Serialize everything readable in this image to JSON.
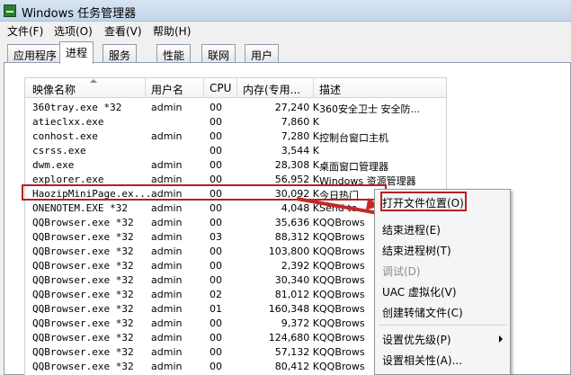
{
  "window": {
    "title": "Windows 任务管理器"
  },
  "menu": [
    "文件(F)",
    "选项(O)",
    "查看(V)",
    "帮助(H)"
  ],
  "tabs": [
    "应用程序",
    "进程",
    "服务",
    "性能",
    "联网",
    "用户"
  ],
  "active_tab": "进程",
  "columns": [
    "映像名称",
    "用户名",
    "CPU",
    "内存(专用...",
    "描述"
  ],
  "rows": [
    {
      "name": "360tray.exe *32",
      "user": "admin",
      "cpu": "00",
      "mem": "27,240 K",
      "desc": "360安全卫士 安全防..."
    },
    {
      "name": "atieclxx.exe",
      "user": "",
      "cpu": "00",
      "mem": "7,860 K",
      "desc": ""
    },
    {
      "name": "conhost.exe",
      "user": "admin",
      "cpu": "00",
      "mem": "7,280 K",
      "desc": "控制台窗口主机"
    },
    {
      "name": "csrss.exe",
      "user": "",
      "cpu": "00",
      "mem": "3,544 K",
      "desc": ""
    },
    {
      "name": "dwm.exe",
      "user": "admin",
      "cpu": "00",
      "mem": "28,308 K",
      "desc": "桌面窗口管理器"
    },
    {
      "name": "explorer.exe",
      "user": "admin",
      "cpu": "00",
      "mem": "56,952 K",
      "desc": "Windows 资源管理器"
    },
    {
      "name": "HaozipMiniPage.ex...",
      "user": "admin",
      "cpu": "00",
      "mem": "30,092 K",
      "desc": "今日热门"
    },
    {
      "name": "ONENOTEM.EXE *32",
      "user": "admin",
      "cpu": "00",
      "mem": "4,048 K",
      "desc": "Send to"
    },
    {
      "name": "QQBrowser.exe *32",
      "user": "admin",
      "cpu": "00",
      "mem": "35,636 K",
      "desc": "QQBrows"
    },
    {
      "name": "QQBrowser.exe *32",
      "user": "admin",
      "cpu": "03",
      "mem": "88,312 K",
      "desc": "QQBrows"
    },
    {
      "name": "QQBrowser.exe *32",
      "user": "admin",
      "cpu": "00",
      "mem": "103,800 K",
      "desc": "QQBrows"
    },
    {
      "name": "QQBrowser.exe *32",
      "user": "admin",
      "cpu": "00",
      "mem": "2,392 K",
      "desc": "QQBrows"
    },
    {
      "name": "QQBrowser.exe *32",
      "user": "admin",
      "cpu": "00",
      "mem": "30,340 K",
      "desc": "QQBrows"
    },
    {
      "name": "QQBrowser.exe *32",
      "user": "admin",
      "cpu": "02",
      "mem": "81,012 K",
      "desc": "QQBrows"
    },
    {
      "name": "QQBrowser.exe *32",
      "user": "admin",
      "cpu": "01",
      "mem": "160,348 K",
      "desc": "QQBrows"
    },
    {
      "name": "QQBrowser.exe *32",
      "user": "admin",
      "cpu": "00",
      "mem": "9,372 K",
      "desc": "QQBrows"
    },
    {
      "name": "QQBrowser.exe *32",
      "user": "admin",
      "cpu": "00",
      "mem": "124,680 K",
      "desc": "QQBrows"
    },
    {
      "name": "QQBrowser.exe *32",
      "user": "admin",
      "cpu": "00",
      "mem": "57,132 K",
      "desc": "QQBrows"
    },
    {
      "name": "QQBrowser.exe *32",
      "user": "admin",
      "cpu": "00",
      "mem": "80,412 K",
      "desc": "QQBrows"
    }
  ],
  "context_menu": [
    "打开文件位置(O)",
    "结束进程(E)",
    "结束进程树(T)",
    "调试(D)",
    "UAC 虚拟化(V)",
    "创建转储文件(C)",
    "设置优先级(P)",
    "设置相关性(A)..."
  ],
  "colors": {
    "highlight": "#b22222",
    "arrow": "#c62828"
  }
}
